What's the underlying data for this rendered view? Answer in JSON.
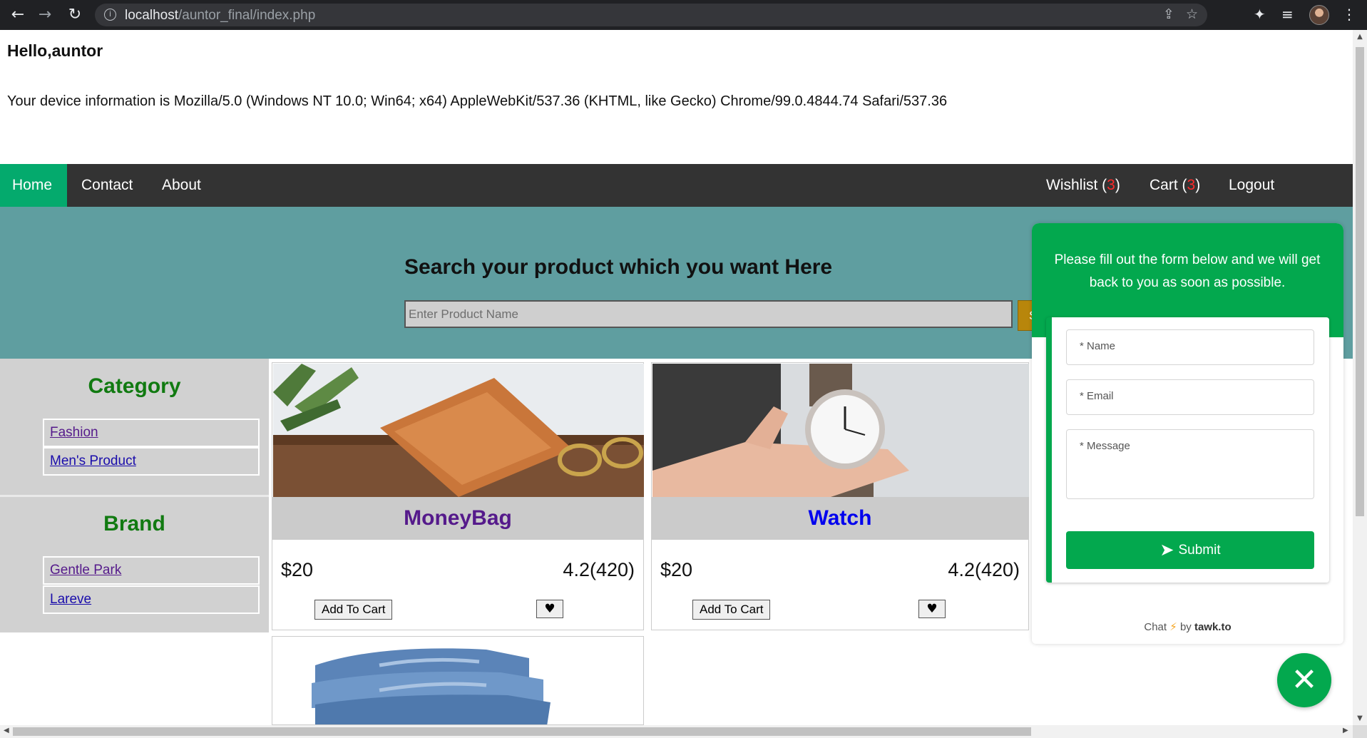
{
  "browser": {
    "url_host": "localhost",
    "url_path": "/auntor_final/index.php"
  },
  "page": {
    "greeting": "Hello,auntor",
    "device_info": "Your device information is Mozilla/5.0 (Windows NT 10.0; Win64; x64) AppleWebKit/537.36 (KHTML, like Gecko) Chrome/99.0.4844.74 Safari/537.36"
  },
  "nav": {
    "home": "Home",
    "contact": "Contact",
    "about": "About",
    "wishlist": "Wishlist",
    "wishlist_count": "3",
    "cart": "Cart",
    "cart_count": "3",
    "logout": "Logout"
  },
  "search": {
    "heading": "Search your product which you want Here",
    "placeholder": "Enter Product Name",
    "button": "S"
  },
  "sidebar": {
    "category_title": "Category",
    "categories": [
      "Fashion",
      "Men's Product"
    ],
    "brand_title": "Brand",
    "brands": [
      "Gentle Park",
      "Lareve"
    ]
  },
  "products": [
    {
      "name": "MoneyBag",
      "price": "$20",
      "rating": "4.2(420)",
      "cart_label": "Add To Cart",
      "title_color": "#551a8b"
    },
    {
      "name": "Watch",
      "price": "$20",
      "rating": "4.2(420)",
      "cart_label": "Add To Cart",
      "title_color": "#0000ee"
    }
  ],
  "chat": {
    "header": "Please fill out the form below and we will get back to you as soon as possible.",
    "name_placeholder": "* Name",
    "email_placeholder": "* Email",
    "message_placeholder": "* Message",
    "submit": "Submit",
    "footer_chat": "Chat",
    "footer_by": "by",
    "footer_brand": "tawk.to"
  },
  "colors": {
    "nav_active": "#04aa6d",
    "hero_bg": "#5f9ea0",
    "chat_green": "#03a84e",
    "sidebar_heading": "#117a11"
  }
}
